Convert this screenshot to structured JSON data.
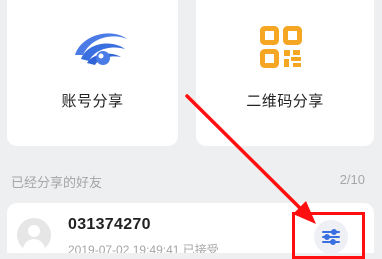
{
  "share_options": {
    "account": {
      "label": "账号分享",
      "icon": "eye-logo-icon",
      "color": "#3a6fe0"
    },
    "qrcode": {
      "label": "二维码分享",
      "icon": "qr-code-icon",
      "color": "#f5a623"
    }
  },
  "shared_friends": {
    "title": "已经分享的好友",
    "count": "2/10",
    "items": [
      {
        "name": "031374270",
        "meta": "2019-07-02 19:49:41 已接受",
        "avatar": "default-avatar-icon",
        "action_icon": "settings-sliders-icon"
      }
    ]
  },
  "annotation": {
    "color": "#ff0f0f"
  }
}
